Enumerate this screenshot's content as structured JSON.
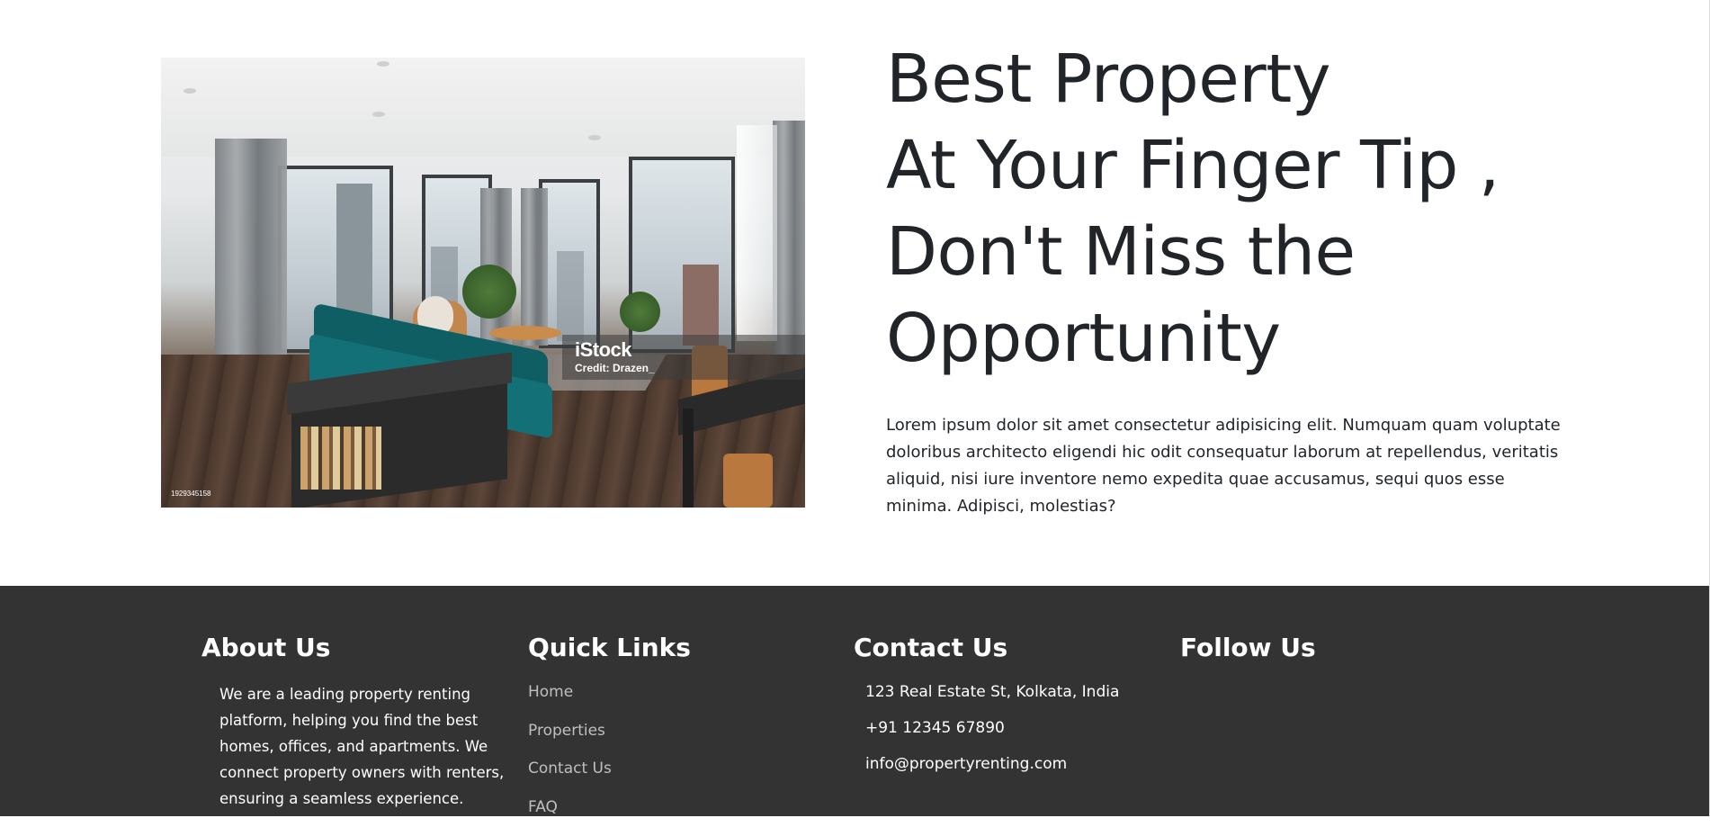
{
  "hero": {
    "heading_lines": [
      "Best Property",
      "At Your Finger Tip ,",
      "Don't Miss the",
      "Opportunity"
    ],
    "paragraph": "Lorem ipsum dolor sit amet consectetur adipisicing elit. Numquam quam voluptate doloribus architecto eligendi hic odit consequatur laborum at repellendus, veritatis aliquid, nisi iure inventore nemo expedita quae accusamus, sequi quos esse minima. Adipisci, molestias?",
    "image": {
      "description_icon": "apartment-living-room-photo",
      "watermark_logo": "iStock",
      "watermark_credit": "Credit: Drazen_",
      "image_id": "1929345158"
    }
  },
  "footer": {
    "about": {
      "title": "About Us",
      "text": "We are a leading property renting platform, helping you find the best homes, offices, and apartments. We connect property owners with renters, ensuring a seamless experience."
    },
    "quick_links": {
      "title": "Quick Links",
      "items": [
        "Home",
        "Properties",
        "Contact Us",
        "FAQ"
      ]
    },
    "contact": {
      "title": "Contact Us",
      "address": "123 Real Estate St, Kolkata, India",
      "phone": "+91 12345 67890",
      "email": "info@propertyrenting.com"
    },
    "follow": {
      "title": "Follow Us"
    },
    "colors": {
      "background": "#333333",
      "link": "#bfbfbf",
      "text": "#ffffff"
    }
  }
}
